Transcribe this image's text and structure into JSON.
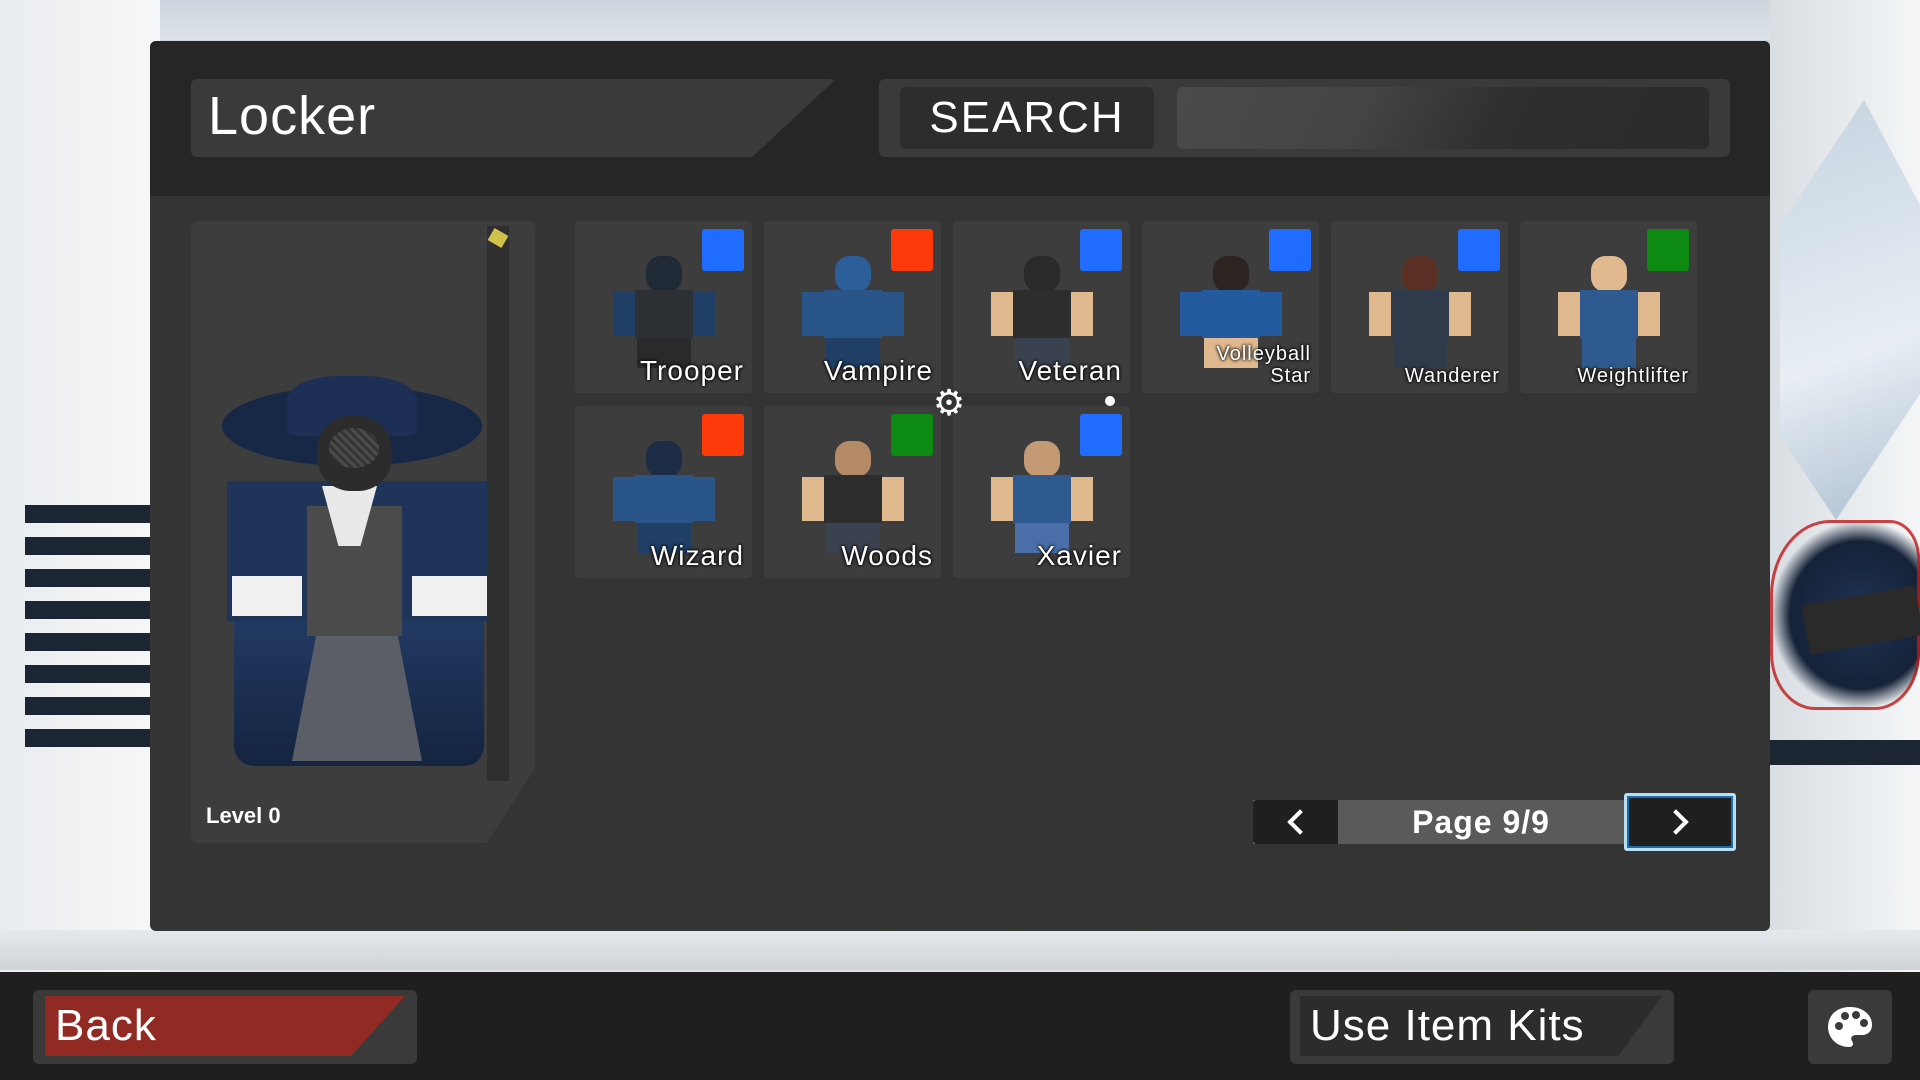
{
  "header": {
    "title": "Locker",
    "search_label": "SEARCH",
    "search_value": "",
    "search_placeholder": ""
  },
  "preview": {
    "level_text": "Level 0"
  },
  "kits": [
    {
      "name": "Trooper",
      "color": "#1f6cff"
    },
    {
      "name": "Vampire",
      "color": "#ff3a0a"
    },
    {
      "name": "Veteran",
      "color": "#1f6cff"
    },
    {
      "name": "Volleyball Star",
      "color": "#1f6cff"
    },
    {
      "name": "Wanderer",
      "color": "#1f6cff"
    },
    {
      "name": "Weightlifter",
      "color": "#0c8a12"
    },
    {
      "name": "Wizard",
      "color": "#ff3a0a"
    },
    {
      "name": "Woods",
      "color": "#0c8a12"
    },
    {
      "name": "Xavier",
      "color": "#1f6cff"
    }
  ],
  "pagination": {
    "label": "Page 9/9"
  },
  "footer": {
    "back_label": "Back",
    "use_kits_label": "Use Item Kits"
  },
  "colors": {
    "panel": "#343434",
    "header": "#262626",
    "back_red": "#922a24",
    "blue": "#1f6cff",
    "orange": "#ff3a0a",
    "green": "#0c8a12"
  }
}
